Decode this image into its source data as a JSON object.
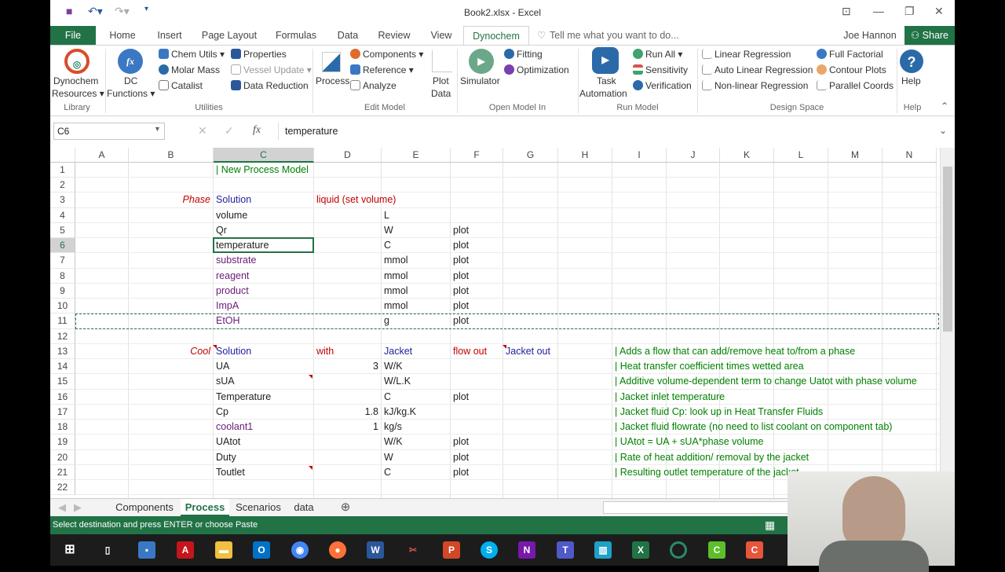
{
  "window": {
    "title": "Book2.xlsx - Excel",
    "user": "Joe Hannon",
    "share": "Share"
  },
  "tabs": [
    "File",
    "Home",
    "Insert",
    "Page Layout",
    "Formulas",
    "Data",
    "Review",
    "View",
    "Dynochem"
  ],
  "tell_me": "Tell me what you want to do...",
  "ribbon": {
    "dyn_resources": [
      "Dynochem",
      "Resources ▾"
    ],
    "dc_functions": [
      "DC",
      "Functions ▾"
    ],
    "chem_utils": "Chem Utils ▾",
    "molar_mass": "Molar Mass",
    "catalist": "Catalist",
    "properties": "Properties",
    "vessel_update": "Vessel Update ▾",
    "data_reduction": "Data Reduction",
    "process": "Process",
    "components": "Components ▾",
    "reference": "Reference ▾",
    "analyze": "Analyze",
    "plot_data": [
      "Plot",
      "Data"
    ],
    "simulator": "Simulator",
    "fitting": "Fitting",
    "optimization": "Optimization",
    "task_automation": [
      "Task",
      "Automation"
    ],
    "run_all": "Run All ▾",
    "sensitivity": "Sensitivity",
    "verification": "Verification",
    "linear_regression": "Linear Regression",
    "auto_linear_regression": "Auto Linear Regression",
    "nonlinear_regression": "Non-linear Regression",
    "full_factorial": "Full Factorial",
    "contour_plots": "Contour Plots",
    "parallel_coords": "Parallel Coords",
    "help": "Help",
    "groups": {
      "library": "Library",
      "utilities": "Utilities",
      "edit_model": "Edit Model",
      "open_model_in": "Open Model In",
      "run_model": "Run Model",
      "design_space": "Design Space",
      "help": "Help"
    }
  },
  "formula_bar": {
    "name_box": "C6",
    "content": "temperature"
  },
  "columns": [
    "A",
    "B",
    "C",
    "D",
    "E",
    "F",
    "G",
    "H",
    "I",
    "J",
    "K",
    "L",
    "M",
    "N"
  ],
  "rows": [
    "1",
    "2",
    "3",
    "4",
    "5",
    "6",
    "7",
    "8",
    "9",
    "10",
    "11",
    "12",
    "13",
    "14",
    "15",
    "16",
    "17",
    "18",
    "19",
    "20",
    "21",
    "22"
  ],
  "colors": {
    "green": "#217346",
    "navy": "#1f1fa0",
    "red": "#c00000",
    "purple": "#6a1b7a",
    "black": "#222222",
    "comment": "#008000"
  },
  "cells": [
    {
      "r": 1,
      "c": "C",
      "t": "| New Process Model",
      "k": "comment"
    },
    {
      "r": 3,
      "c": "B",
      "t": "Phase",
      "k": "red",
      "i": true,
      "a": "right"
    },
    {
      "r": 3,
      "c": "C",
      "t": "Solution",
      "k": "navy"
    },
    {
      "r": 3,
      "c": "D",
      "t": "liquid (set volume)",
      "k": "red"
    },
    {
      "r": 4,
      "c": "C",
      "t": "volume"
    },
    {
      "r": 4,
      "c": "E",
      "t": "L"
    },
    {
      "r": 5,
      "c": "C",
      "t": "Qr"
    },
    {
      "r": 5,
      "c": "E",
      "t": "W"
    },
    {
      "r": 5,
      "c": "F",
      "t": "plot"
    },
    {
      "r": 6,
      "c": "C",
      "t": "temperature"
    },
    {
      "r": 6,
      "c": "E",
      "t": "C"
    },
    {
      "r": 6,
      "c": "F",
      "t": "plot"
    },
    {
      "r": 7,
      "c": "C",
      "t": "substrate",
      "k": "purple"
    },
    {
      "r": 7,
      "c": "E",
      "t": "mmol"
    },
    {
      "r": 7,
      "c": "F",
      "t": "plot"
    },
    {
      "r": 8,
      "c": "C",
      "t": "reagent",
      "k": "purple"
    },
    {
      "r": 8,
      "c": "E",
      "t": "mmol"
    },
    {
      "r": 8,
      "c": "F",
      "t": "plot"
    },
    {
      "r": 9,
      "c": "C",
      "t": "product",
      "k": "purple"
    },
    {
      "r": 9,
      "c": "E",
      "t": "mmol"
    },
    {
      "r": 9,
      "c": "F",
      "t": "plot"
    },
    {
      "r": 10,
      "c": "C",
      "t": "ImpA",
      "k": "purple"
    },
    {
      "r": 10,
      "c": "E",
      "t": "mmol"
    },
    {
      "r": 10,
      "c": "F",
      "t": "plot"
    },
    {
      "r": 11,
      "c": "C",
      "t": "EtOH",
      "k": "purple"
    },
    {
      "r": 11,
      "c": "E",
      "t": "g"
    },
    {
      "r": 11,
      "c": "F",
      "t": "plot"
    },
    {
      "r": 13,
      "c": "B",
      "t": "Cool",
      "k": "red",
      "i": true,
      "a": "right"
    },
    {
      "r": 13,
      "c": "C",
      "t": "Solution",
      "k": "navy"
    },
    {
      "r": 13,
      "c": "D",
      "t": "with",
      "k": "red"
    },
    {
      "r": 13,
      "c": "E",
      "t": "Jacket",
      "k": "navy"
    },
    {
      "r": 13,
      "c": "F",
      "t": "flow out",
      "k": "red"
    },
    {
      "r": 13,
      "c": "G",
      "t": "Jacket out",
      "k": "navy"
    },
    {
      "r": 13,
      "c": "I",
      "t": "| Adds a flow that can add/remove heat to/from a phase",
      "k": "comment"
    },
    {
      "r": 14,
      "c": "C",
      "t": "UA"
    },
    {
      "r": 14,
      "c": "D",
      "t": "3",
      "a": "right"
    },
    {
      "r": 14,
      "c": "E",
      "t": "W/K"
    },
    {
      "r": 14,
      "c": "I",
      "t": "| Heat transfer coefficient times wetted area",
      "k": "comment"
    },
    {
      "r": 15,
      "c": "C",
      "t": "sUA"
    },
    {
      "r": 15,
      "c": "E",
      "t": "W/L.K"
    },
    {
      "r": 15,
      "c": "I",
      "t": "| Additive volume-dependent term to change Uatot with phase volume",
      "k": "comment"
    },
    {
      "r": 16,
      "c": "C",
      "t": "Temperature"
    },
    {
      "r": 16,
      "c": "E",
      "t": "C"
    },
    {
      "r": 16,
      "c": "F",
      "t": "plot"
    },
    {
      "r": 16,
      "c": "I",
      "t": "| Jacket inlet temperature",
      "k": "comment"
    },
    {
      "r": 17,
      "c": "C",
      "t": "Cp"
    },
    {
      "r": 17,
      "c": "D",
      "t": "1.8",
      "a": "right"
    },
    {
      "r": 17,
      "c": "E",
      "t": "kJ/kg.K"
    },
    {
      "r": 17,
      "c": "I",
      "t": "| Jacket fluid Cp: look up in Heat Transfer Fluids",
      "k": "comment"
    },
    {
      "r": 18,
      "c": "C",
      "t": "coolant1",
      "k": "purple"
    },
    {
      "r": 18,
      "c": "D",
      "t": "1",
      "a": "right"
    },
    {
      "r": 18,
      "c": "E",
      "t": "kg/s"
    },
    {
      "r": 18,
      "c": "I",
      "t": "| Jacket fluid flowrate (no need to list coolant on component tab)",
      "k": "comment"
    },
    {
      "r": 19,
      "c": "C",
      "t": "UAtot"
    },
    {
      "r": 19,
      "c": "E",
      "t": "W/K"
    },
    {
      "r": 19,
      "c": "F",
      "t": "plot"
    },
    {
      "r": 19,
      "c": "I",
      "t": "| UAtot = UA + sUA*phase volume",
      "k": "comment"
    },
    {
      "r": 20,
      "c": "C",
      "t": "Duty"
    },
    {
      "r": 20,
      "c": "E",
      "t": "W"
    },
    {
      "r": 20,
      "c": "F",
      "t": "plot"
    },
    {
      "r": 20,
      "c": "I",
      "t": "| Rate of heat addition/ removal by the jacket",
      "k": "comment"
    },
    {
      "r": 21,
      "c": "C",
      "t": "Toutlet"
    },
    {
      "r": 21,
      "c": "E",
      "t": "C"
    },
    {
      "r": 21,
      "c": "F",
      "t": "plot"
    },
    {
      "r": 21,
      "c": "I",
      "t": "| Resulting outlet temperature of the jacket",
      "k": "comment"
    }
  ],
  "sheets": [
    "Components",
    "Process",
    "Scenarios",
    "data"
  ],
  "active_sheet": "Process",
  "status": "Select destination and press ENTER or choose Paste"
}
